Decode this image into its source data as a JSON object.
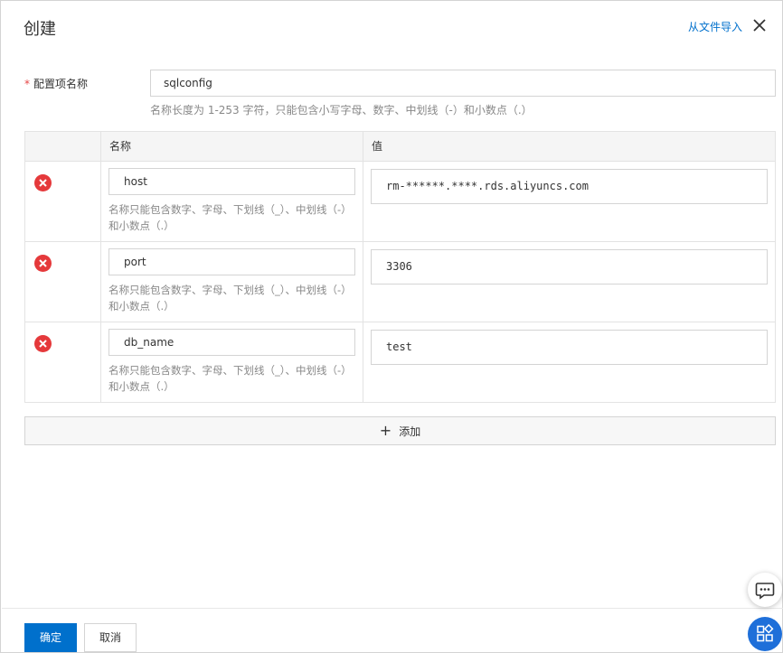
{
  "header": {
    "title": "创建",
    "import_link": "从文件导入"
  },
  "config_name": {
    "required_mark": "*",
    "label": "配置项名称",
    "value": "sqlconfig",
    "help": "名称长度为 1-253 字符，只能包含小写字母、数字、中划线（-）和小数点（.）"
  },
  "table": {
    "columns": [
      "",
      "名称",
      "值"
    ],
    "key_help": "名称只能包含数字、字母、下划线（_）、中划线（-）和小数点（.）",
    "rows": [
      {
        "key": "host",
        "value": "rm-******.****.rds.aliyuncs.com"
      },
      {
        "key": "port",
        "value": "3306"
      },
      {
        "key": "db_name",
        "value": "test"
      }
    ]
  },
  "add_button": {
    "icon": "+",
    "label": "添加"
  },
  "footer": {
    "ok_label": "确定",
    "cancel_label": "取消"
  },
  "colors": {
    "primary": "#0070cc",
    "danger": "#e5393b",
    "float_accent": "#1e6fd9"
  },
  "icons": {
    "close": "close-icon",
    "delete": "delete-circle-icon",
    "chat": "chat-icon",
    "apps": "apps-grid-icon"
  }
}
